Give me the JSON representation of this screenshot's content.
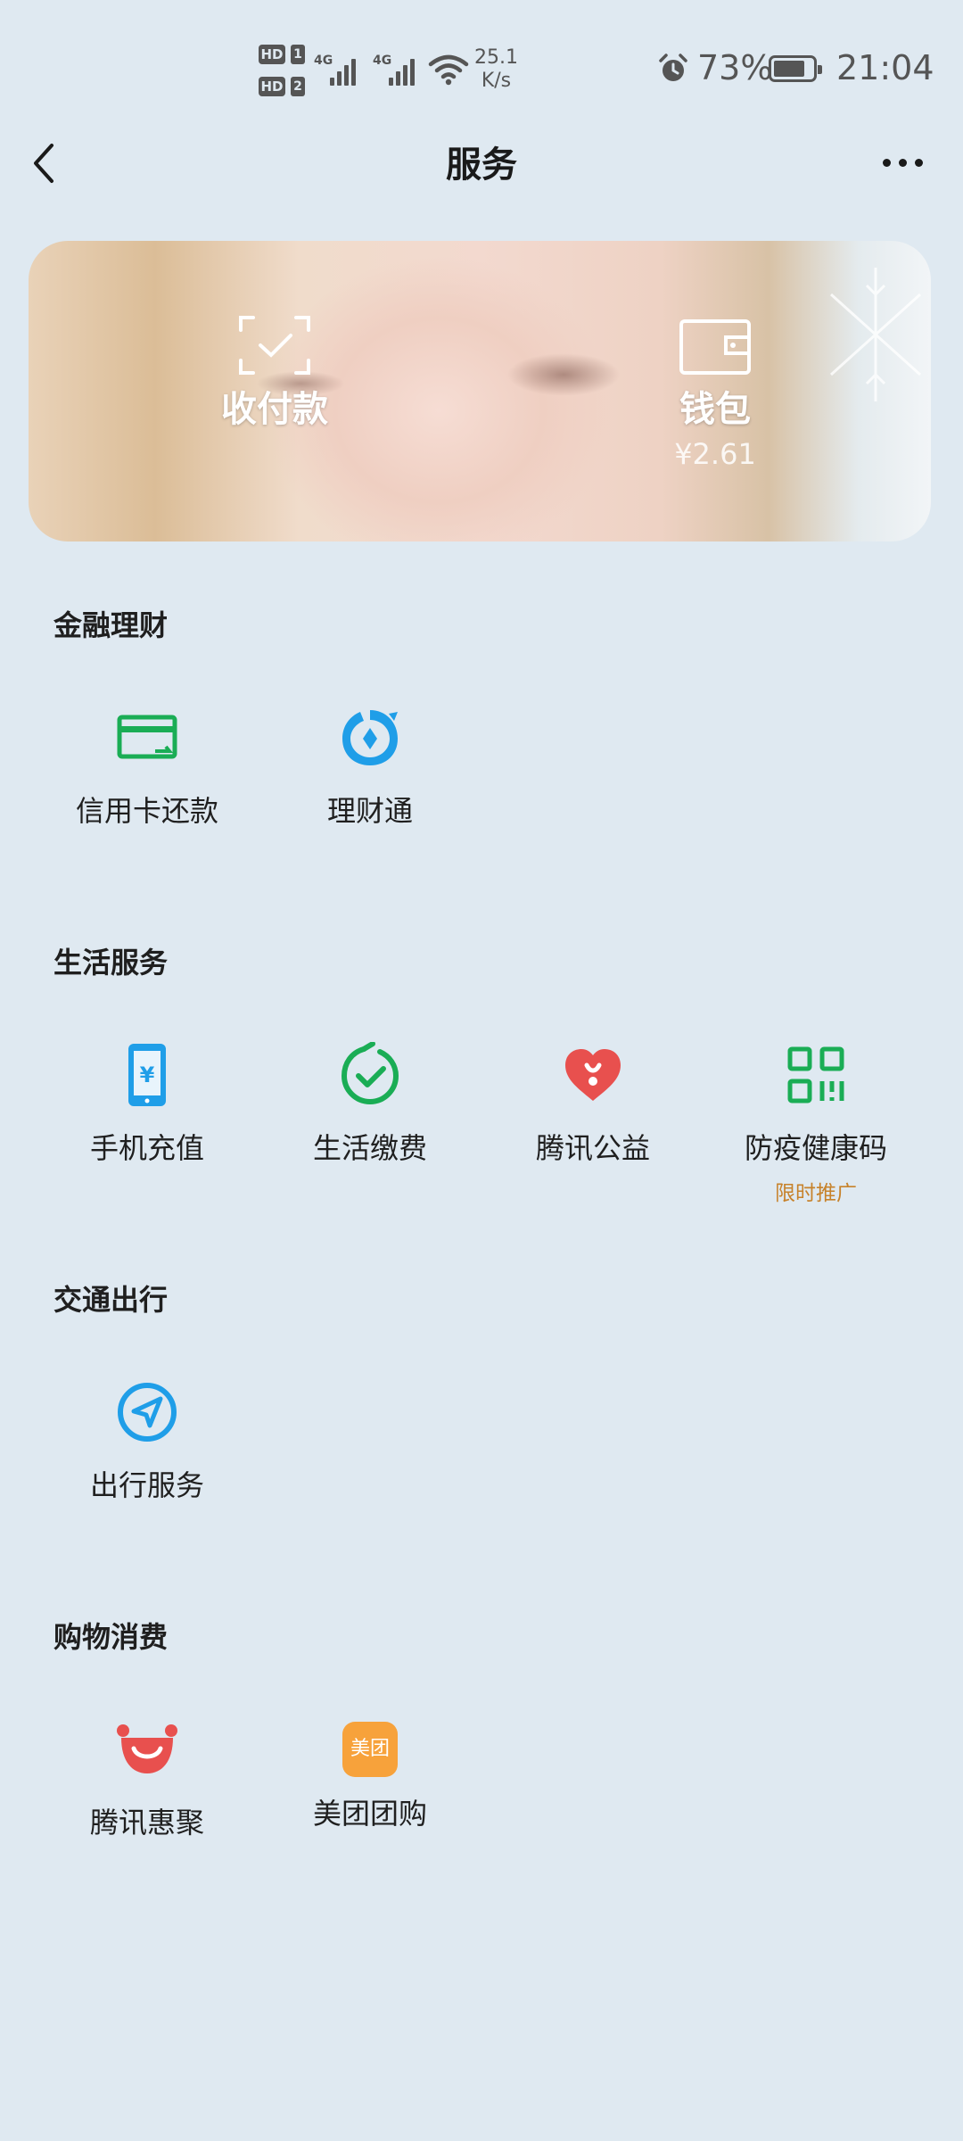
{
  "status_bar": {
    "hd1": "HD",
    "sim1": "1",
    "hd2": "HD",
    "sim2": "2",
    "net1": "4G",
    "net2": "4G",
    "speed_value": "25.1",
    "speed_unit": "K/s",
    "battery_percent": "73%",
    "time": "21:04"
  },
  "nav": {
    "title": "服务"
  },
  "banner": {
    "pay": {
      "label": "收付款"
    },
    "wallet": {
      "label": "钱包",
      "balance": "¥2.61"
    }
  },
  "sections": [
    {
      "title": "金融理财",
      "items": [
        {
          "label": "信用卡还款",
          "icon": "credit-card-icon"
        },
        {
          "label": "理财通",
          "icon": "wealth-drop-icon"
        }
      ]
    },
    {
      "title": "生活服务",
      "items": [
        {
          "label": "手机充值",
          "icon": "phone-recharge-icon"
        },
        {
          "label": "生活缴费",
          "icon": "bill-check-icon"
        },
        {
          "label": "腾讯公益",
          "icon": "charity-heart-icon"
        },
        {
          "label": "防疫健康码",
          "icon": "qr-code-icon",
          "tag": "限时推广"
        }
      ]
    },
    {
      "title": "交通出行",
      "items": [
        {
          "label": "出行服务",
          "icon": "navigation-icon"
        }
      ]
    },
    {
      "title": "购物消费",
      "items": [
        {
          "label": "腾讯惠聚",
          "icon": "smile-bag-icon"
        },
        {
          "label": "美团团购",
          "icon": "meituan-icon",
          "icon_text": "美团"
        }
      ]
    }
  ],
  "colors": {
    "background": "#dfe9f1",
    "green": "#1aad55",
    "blue": "#1f9ee8",
    "red": "#e8504e",
    "orange": "#f7a23b",
    "promo": "#c7822b"
  }
}
